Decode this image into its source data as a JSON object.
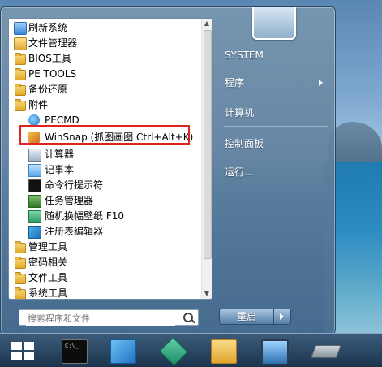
{
  "menu": {
    "items": [
      {
        "label": "刷新系统",
        "icon": "refresh-system-icon"
      },
      {
        "label": "文件管理器",
        "icon": "file-manager-icon"
      },
      {
        "label": "BIOS工具",
        "icon": "folder-icon"
      },
      {
        "label": "PE TOOLS",
        "icon": "folder-icon"
      },
      {
        "label": "备份还原",
        "icon": "folder-icon"
      },
      {
        "label": "附件",
        "icon": "folder-icon"
      },
      {
        "label": "PECMD",
        "icon": "pecmd-icon"
      },
      {
        "label": "WinSnap (抓图画图 Ctrl+Alt+K)",
        "icon": "winsnap-icon"
      },
      {
        "label": "计算器",
        "icon": "calculator-icon"
      },
      {
        "label": "记事本",
        "icon": "notepad-icon"
      },
      {
        "label": "命令行提示符",
        "icon": "command-prompt-icon"
      },
      {
        "label": "任务管理器",
        "icon": "task-manager-icon"
      },
      {
        "label": "随机换幅壁纸 F10",
        "icon": "wallpaper-icon"
      },
      {
        "label": "注册表编辑器",
        "icon": "registry-editor-icon"
      },
      {
        "label": "管理工具",
        "icon": "folder-icon"
      },
      {
        "label": "密码相关",
        "icon": "folder-icon"
      },
      {
        "label": "文件工具",
        "icon": "folder-icon"
      },
      {
        "label": "系统工具",
        "icon": "folder-icon"
      }
    ],
    "search_placeholder": "搜索程序和文件"
  },
  "right": {
    "system": "SYSTEM",
    "programs": "程序",
    "computer": "计算机",
    "control_panel": "控制面板",
    "run": "运行..."
  },
  "shutdown": {
    "label": "重启"
  },
  "taskbar": {
    "items": [
      "start-button",
      "command-prompt",
      "notebook",
      "cubes-app",
      "explorer",
      "monitor-app",
      "hardware-app"
    ]
  },
  "colors": {
    "highlight_border": "#e0231c"
  }
}
